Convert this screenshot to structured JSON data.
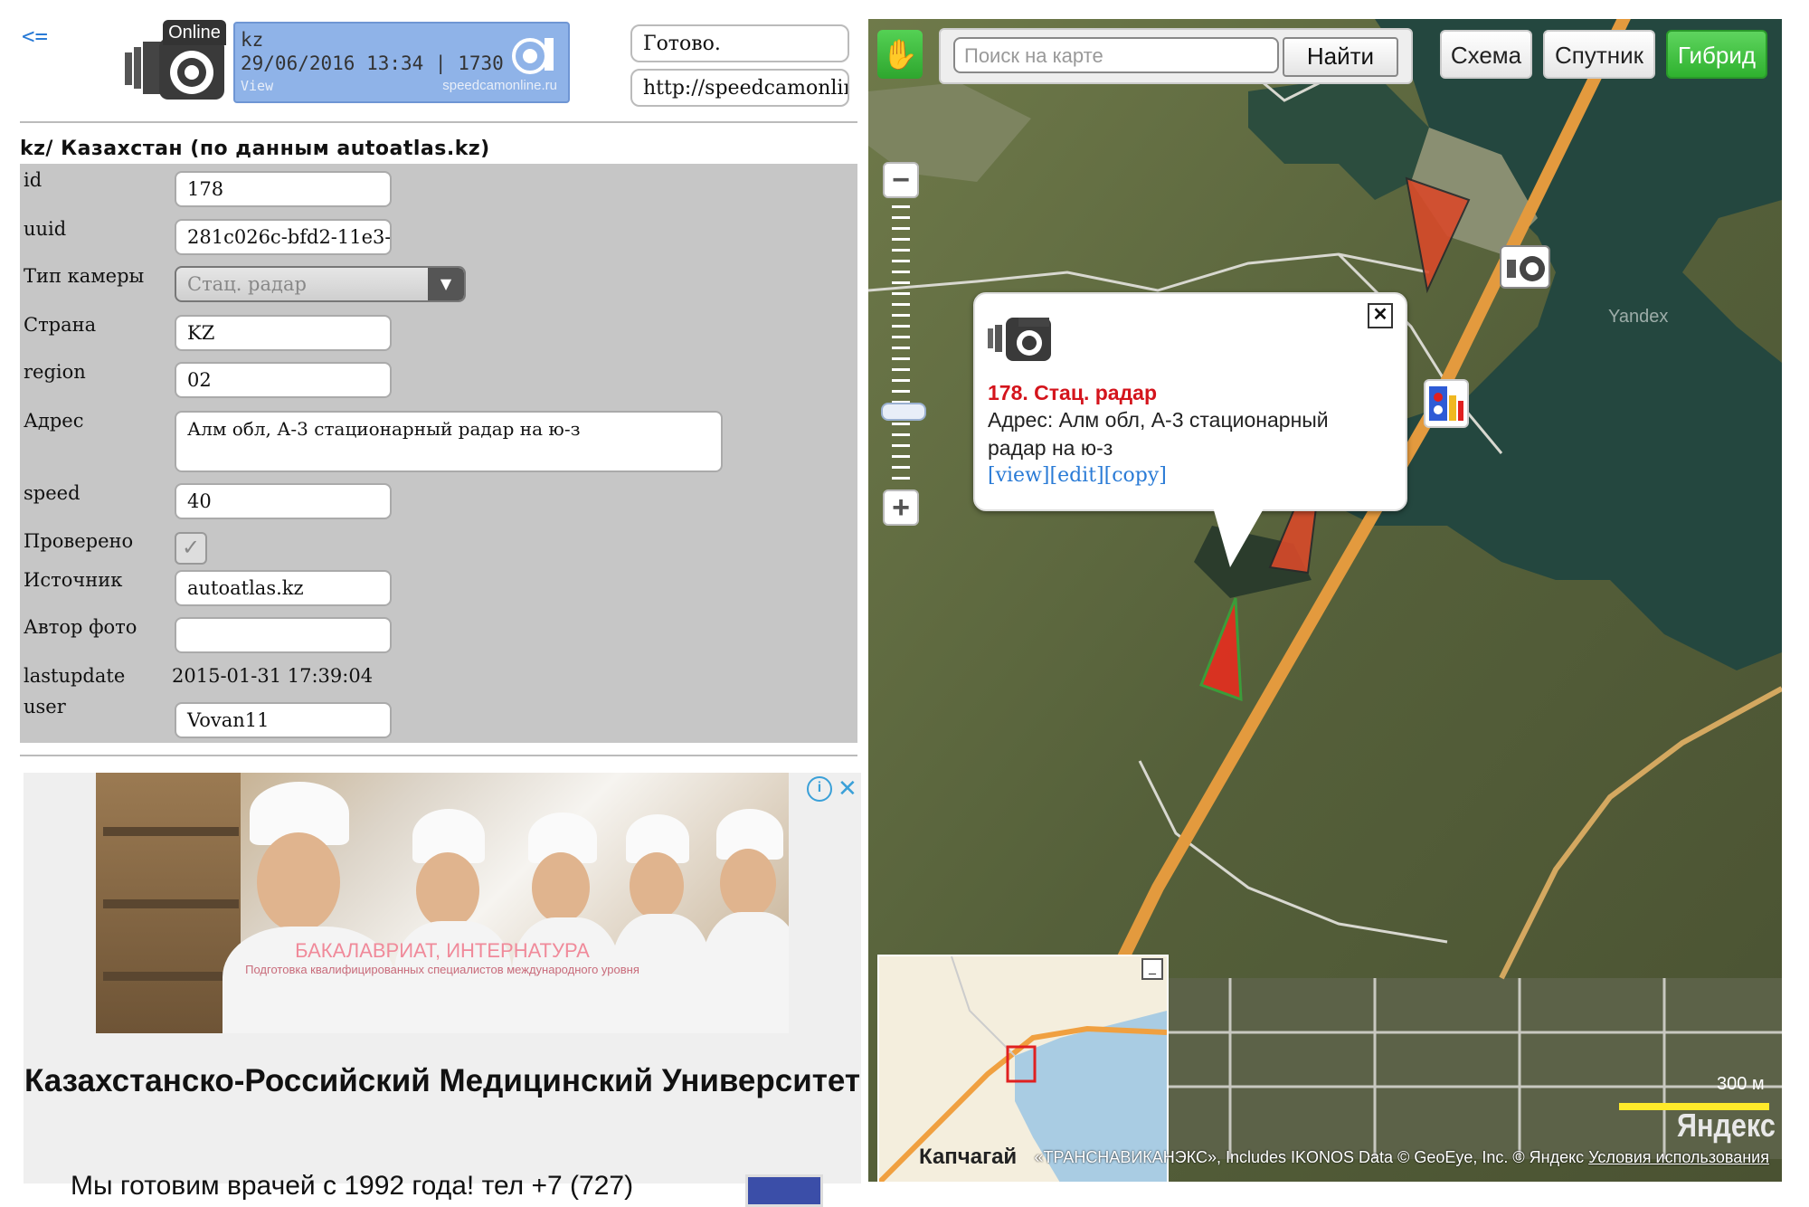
{
  "header": {
    "back_link": "<=",
    "logo_text": "Online",
    "widget": {
      "line1": "kz",
      "line2": "29/06/2016 13:34 | 1730",
      "line3": "View",
      "site": "speedcamonline.ru"
    },
    "status": "Готово.",
    "url": "http://speedcamonline.ru"
  },
  "country_title": "kz/ Казахстан (по данным autoatlas.kz)",
  "form": {
    "id": {
      "label": "id",
      "value": "178"
    },
    "uuid": {
      "label": "uuid",
      "value": "281c026c-bfd2-11e3-"
    },
    "type": {
      "label": "Тип камеры",
      "value": "Стац. радар"
    },
    "country": {
      "label": "Страна",
      "value": "KZ"
    },
    "region": {
      "label": "region",
      "value": "02"
    },
    "address": {
      "label": "Адрес",
      "value": "Алм обл, А-3 стационарный радар на ю-з"
    },
    "speed": {
      "label": "speed",
      "value": "40"
    },
    "checked": {
      "label": "Проверено",
      "value": true
    },
    "source": {
      "label": "Источник",
      "value": "autoatlas.kz"
    },
    "photo_author": {
      "label": "Автор фото",
      "value": ""
    },
    "lastupdate": {
      "label": "lastupdate",
      "value": "2015-01-31 17:39:04"
    },
    "user": {
      "label": "user",
      "value": "Vovan11"
    }
  },
  "ad": {
    "caption1": "БАКАЛАВРИАТ, ИНТЕРНАТУРА",
    "caption2": "Подготовка квалифицированных специалистов международного уровня",
    "info_icon": "info-icon",
    "close_icon": "close-icon",
    "title": "Казахстанско-Российский Медицинский Университет",
    "text": "Мы готовим врачей с 1992 года! тел +7 (727)"
  },
  "map": {
    "search_placeholder": "Поиск на карте",
    "search_button": "Найти",
    "view_buttons": {
      "scheme": "Схема",
      "satellite": "Спутник",
      "hybrid": "Гибрид"
    },
    "active_view": "Гибрид",
    "popup": {
      "title": "178. Стац. радар",
      "address": "Адрес: Алм обл, А-3 стационарный радар на ю-з",
      "link_view": "[view]",
      "link_edit": "[edit]",
      "link_copy": "[copy]"
    },
    "watermark": "Yandex",
    "minimap_label": "Капчагай",
    "scale": "300 м",
    "logo": "Яндекс",
    "copyright": "«ТРАНСНАВИКАНЭКС», Includes IKONOS Data © GeoEye, Inc. © Яндекс",
    "terms": "Условия использования",
    "colors": {
      "accent_green": "#2fb22f",
      "popup_title": "#d4141c",
      "link": "#2a7bd6",
      "road": "#e39a3e"
    }
  }
}
